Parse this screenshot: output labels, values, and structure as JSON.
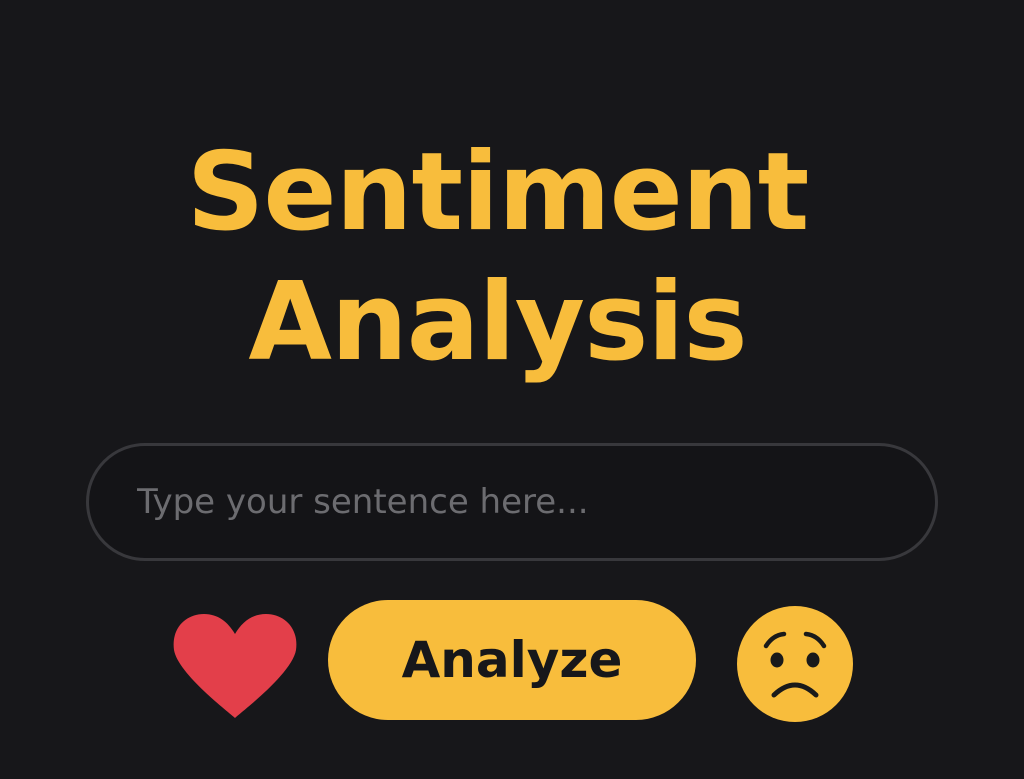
{
  "header": {
    "title_line1": "Sentiment",
    "title_line2": "Analysis"
  },
  "input": {
    "placeholder": "Type your sentence here...",
    "value": ""
  },
  "actions": {
    "analyze_label": "Analyze",
    "positive_icon": "heart-icon",
    "negative_icon": "sad-face-icon"
  },
  "colors": {
    "background": "#17171a",
    "accent": "#f8bd3c",
    "heart": "#e33f4a",
    "input_border": "#38383c",
    "placeholder": "#6c6c70"
  }
}
